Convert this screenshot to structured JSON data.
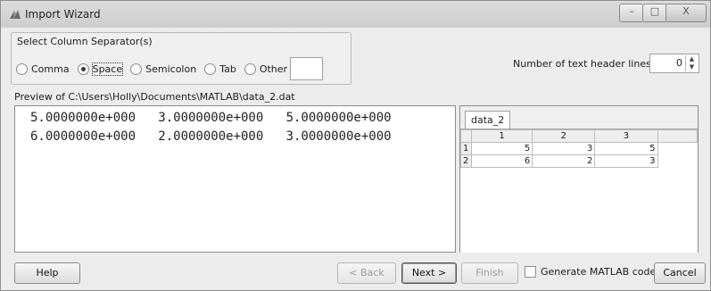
{
  "window": {
    "title": "Import Wizard",
    "icon": "matlab-icon"
  },
  "controls": {
    "minimize": "–",
    "maximize": "□",
    "close": "X"
  },
  "separator": {
    "group_label": "Select Column Separator(s)",
    "options": [
      {
        "label": "Comma",
        "selected": false
      },
      {
        "label": "Space",
        "selected": true
      },
      {
        "label": "Semicolon",
        "selected": false
      },
      {
        "label": "Tab",
        "selected": false
      },
      {
        "label": "Other",
        "selected": false
      }
    ],
    "other_value": ""
  },
  "header_lines": {
    "label": "Number of text header lines:",
    "value": "0"
  },
  "preview": {
    "label": "Preview of C:\\Users\\Holly\\Documents\\MATLAB\\data_2.dat",
    "rows": [
      "5.0000000e+000   3.0000000e+000   5.0000000e+000",
      "6.0000000e+000   2.0000000e+000   3.0000000e+000"
    ]
  },
  "variable_grid": {
    "tab": "data_2",
    "columns": [
      "1",
      "2",
      "3"
    ],
    "rows": [
      {
        "index": "1",
        "values": [
          "5",
          "3",
          "5"
        ]
      },
      {
        "index": "2",
        "values": [
          "6",
          "2",
          "3"
        ]
      }
    ]
  },
  "buttons": {
    "help": "Help",
    "back": "< Back",
    "next": "Next >",
    "finish": "Finish",
    "generate": "Generate MATLAB code",
    "cancel": "Cancel"
  }
}
